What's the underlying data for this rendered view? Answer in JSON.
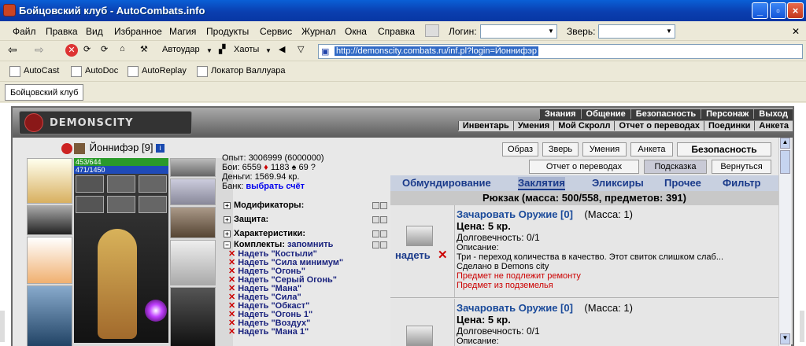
{
  "window": {
    "title": "Бойцовский клуб - AutoCombats.info"
  },
  "menu": {
    "items": [
      "Файл",
      "Правка",
      "Вид",
      "Избранное",
      "Магия",
      "Продукты",
      "Сервис",
      "Журнал",
      "Окна",
      "Справка"
    ],
    "login_label": "Логин:",
    "beast_label": "Зверь:"
  },
  "toolbar": {
    "autoudar": "Автоудар",
    "chaos": "Хаоты",
    "url": "http://demonscity.combats.ru/inf.pl?login=Йоннифэр"
  },
  "links": [
    "AutoCast",
    "AutoDoc",
    "AutoReplay",
    "Локатор Валлуара"
  ],
  "tab": {
    "label": "Бойцовский клуб"
  },
  "site": {
    "logo": "DEMONSCITY",
    "topnav": [
      "Знания",
      "Общение",
      "Безопасность",
      "Персонаж",
      "Выход"
    ],
    "subnav": [
      "Инвентарь",
      "Умения",
      "Мой Скролл",
      "Отчет о переводах",
      "Поединки",
      "Анкета"
    ]
  },
  "character": {
    "name": "Йоннифэр",
    "level": "[9]",
    "hp": "453/644",
    "mp": "471/1450",
    "exp": "Опыт: 3006999 (6000000)",
    "fights": "Бои:   6559",
    "wins": "1183",
    "draws": "69",
    "money": "Деньги: 1569.94 кр.",
    "bank_label": "Банк:",
    "bank_link": "выбрать счёт"
  },
  "sections": {
    "mods": "Модификаторы:",
    "defense": "Защита:",
    "chars": "Характеристики:",
    "kits": "Комплекты:",
    "remember": "запомнить"
  },
  "kits": [
    "Надеть \"Костыли\"",
    "Надеть \"Сила минимум\"",
    "Надеть \"Огонь\"",
    "Надеть \"Серый Огонь\"",
    "Надеть \"Мана\"",
    "Надеть \"Сила\"",
    "Надеть \"Обкаст\"",
    "Надеть \"Огонь 1\"",
    "Надеть \"Воздух\"",
    "Надеть \"Мана 1\""
  ],
  "buttons": {
    "image": "Образ",
    "beast": "Зверь",
    "skills": "Умения",
    "profile": "Анкета",
    "security": "Безопасность",
    "transfers": "Отчет о переводах",
    "hint": "Подсказка",
    "back": "Вернуться"
  },
  "inventory": {
    "tabs": [
      "Обмундирование",
      "Заклятия",
      "Эликсиры",
      "Прочее",
      "Фильтр"
    ],
    "active_tab": "Заклятия",
    "backpack": "Рюкзак (масса: 500/558, предметов: 391)",
    "wear_label": "надеть",
    "items": [
      {
        "name": "Зачаровать Оружие [0]",
        "mass": "(Масса: 1)",
        "price": "Цена: 5 кр.",
        "durability": "Долговечность: 0/1",
        "desc_label": "Описание:",
        "desc": "Три - переход количества в качество. Этот свиток слишком слаб...",
        "made": "Сделано в Demons city",
        "note1": "Предмет не подлежит ремонту",
        "note2": "Предмет из подземелья"
      },
      {
        "name": "Зачаровать Оружие [0]",
        "mass": "(Масса: 1)",
        "price": "Цена: 5 кр.",
        "durability": "Долговечность: 0/1",
        "desc_label": "Описание:"
      }
    ]
  },
  "colors": {
    "title_blue": "#0a3fb0",
    "link_blue": "#1a3a8a",
    "warning_red": "#c00000"
  }
}
